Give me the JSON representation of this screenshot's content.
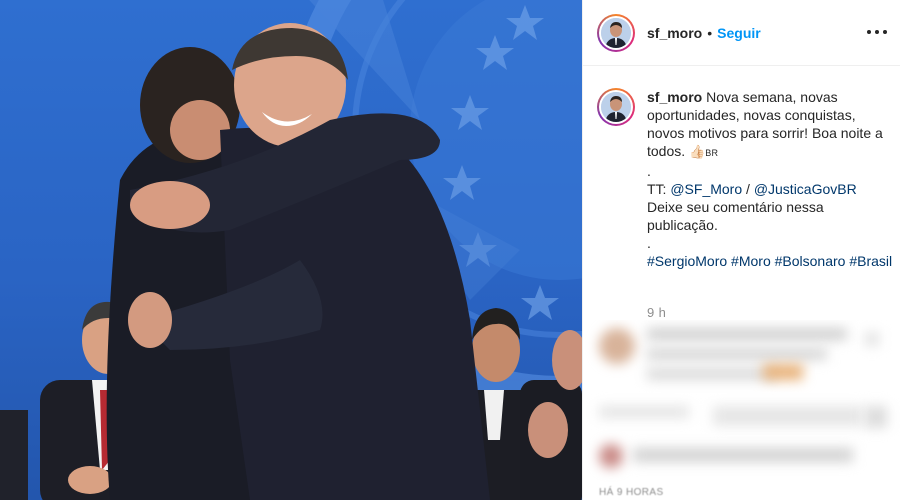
{
  "post": {
    "author": {
      "username": "sf_moro",
      "follow_label": "Seguir",
      "separator": "•"
    },
    "caption": {
      "username": "sf_moro",
      "text": "Nova semana, novas oportunidades, novas conquistas, novos motivos para sorrir! Boa noite a todos.",
      "emoji_thumb": "👍🏻",
      "flag_text": "BR",
      "dot1": ".",
      "tt_prefix": "TT: ",
      "mention1": "@SF_Moro",
      "mention_sep": " / ",
      "mention2": "@JusticaGovBR",
      "cta": "Deixe seu comentário nessa publicação.",
      "dot2": ".",
      "hashtags": [
        "#SergioMoro",
        "#Moro",
        "#Bolsonaro",
        "#Brasil"
      ]
    },
    "caption_time": "9 h",
    "footer_time": "HÁ 9 HORAS"
  },
  "icons": {
    "more": "more-options-icon",
    "avatar": "profile-avatar"
  },
  "colors": {
    "link_blue": "#0095f6",
    "hashtag_blue": "#00376b",
    "photo_background": "#2f6fd0",
    "muted_gray": "#8e8e8e"
  }
}
